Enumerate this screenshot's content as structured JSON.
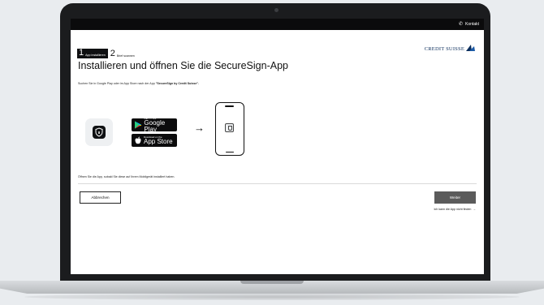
{
  "header": {
    "contact_label": "Kontakt",
    "contact_icon": "phone-icon"
  },
  "brand": {
    "logo_text": "CREDIT SUISSE",
    "logo_color": "#0b2d5b"
  },
  "stepper": {
    "steps": [
      {
        "number": "1",
        "label": "App installieren",
        "active": true
      },
      {
        "number": "2",
        "label": "Brief scannen",
        "active": false
      }
    ]
  },
  "page": {
    "title": "Installieren und öffnen Sie die SecureSign-App",
    "instruction_prefix": "Suchen Sie in Google Play oder im App Store nach der App ",
    "instruction_app": "\"SecureSign by Credit Suisse\".",
    "hint": "Öffnen Sie die App, sobald Sie diese auf Ihrem Mobilgerät installiert haben."
  },
  "stores": {
    "google": {
      "small": "GET IT ON",
      "big": "Google Play"
    },
    "apple": {
      "small": "Download on the",
      "big": "App Store"
    }
  },
  "arrow_symbol": "→",
  "actions": {
    "cancel_label": "Abbrechen",
    "next_label": "Weiter",
    "next_color": "#5b5b5b",
    "cant_find_label": "Ich kann die App nicht finden",
    "cant_find_arrow": "→"
  }
}
